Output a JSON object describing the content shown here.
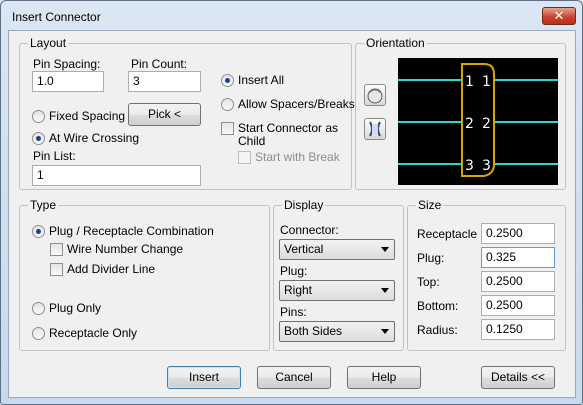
{
  "window": {
    "title": "Insert Connector",
    "close_glyph": "✕"
  },
  "layout": {
    "group_label": "Layout",
    "pin_spacing_label": "Pin Spacing:",
    "pin_spacing_value": "1.0",
    "pin_count_label": "Pin Count:",
    "pin_count_value": "3",
    "insert_all_label": "Insert All",
    "allow_spacers_label": "Allow Spacers/Breaks",
    "fixed_spacing_label": "Fixed Spacing",
    "pick_button": "Pick <",
    "at_wire_crossing_label": "At Wire Crossing",
    "start_child_label_line1": "Start Connector as",
    "start_child_label_line2": "Child",
    "start_with_break_label": "Start with Break",
    "pin_list_label": "Pin List:",
    "pin_list_value": "1"
  },
  "orientation": {
    "group_label": "Orientation",
    "pins": [
      "1",
      "2",
      "3"
    ],
    "icons": [
      "connector-round-icon",
      "connector-split-icon"
    ],
    "colors": {
      "wire": "#2fd3d3",
      "body": "#e0a000",
      "pin_text": "#ffffff",
      "background": "#000000"
    }
  },
  "type": {
    "group_label": "Type",
    "plug_receptacle_label": "Plug / Receptacle Combination",
    "wire_number_change_label": "Wire Number Change",
    "add_divider_line_label": "Add Divider Line",
    "plug_only_label": "Plug Only",
    "receptacle_only_label": "Receptacle Only"
  },
  "display": {
    "group_label": "Display",
    "connector_label": "Connector:",
    "connector_value": "Vertical",
    "plug_label": "Plug:",
    "plug_value": "Right",
    "pins_label": "Pins:",
    "pins_value": "Both Sides"
  },
  "size": {
    "group_label": "Size",
    "receptacle_label": "Receptacle",
    "receptacle_value": "0.2500",
    "plug_label": "Plug:",
    "plug_value": "0.325",
    "top_label": "Top:",
    "top_value": "0.2500",
    "bottom_label": "Bottom:",
    "bottom_value": "0.2500",
    "radius_label": "Radius:",
    "radius_value": "0.1250"
  },
  "buttons": {
    "insert": "Insert",
    "cancel": "Cancel",
    "help": "Help",
    "details": "Details <<"
  }
}
